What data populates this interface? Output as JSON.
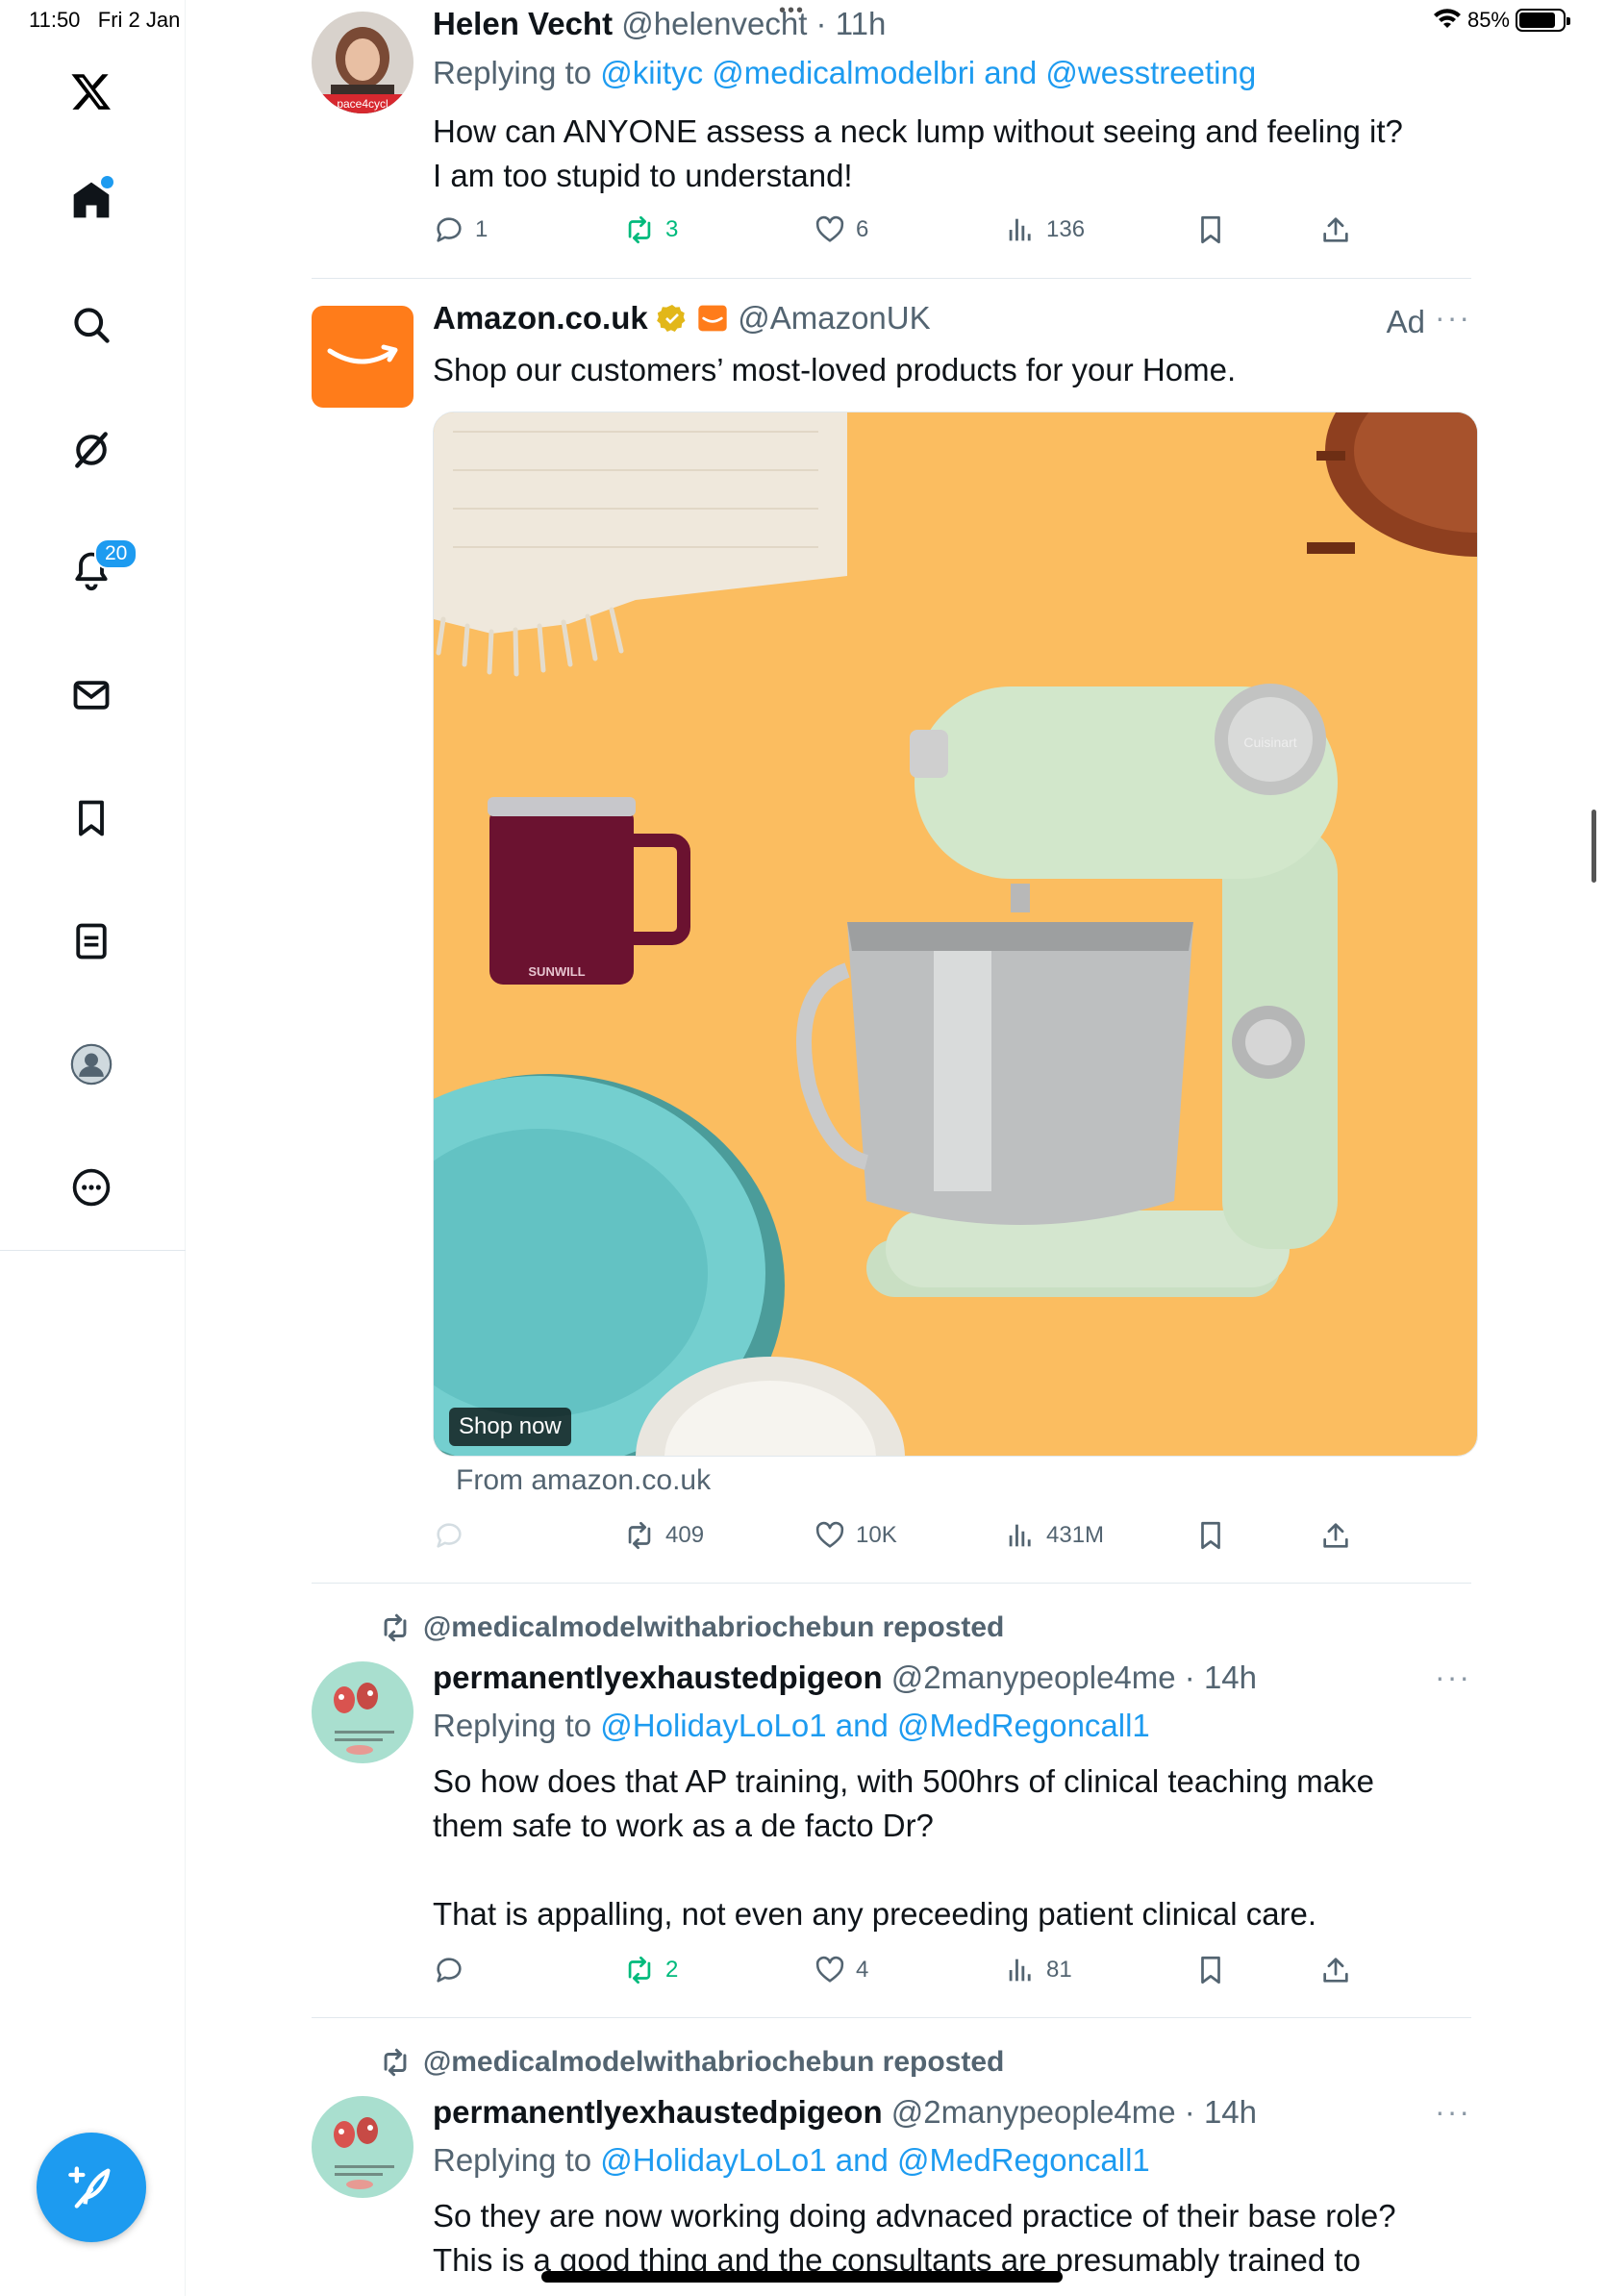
{
  "status_bar": {
    "time": "11:50",
    "date": "Fri 2 Jan",
    "battery": "85%"
  },
  "sidebar": {
    "items": [
      {
        "name": "x-logo-icon"
      },
      {
        "name": "home-icon"
      },
      {
        "name": "search-icon"
      },
      {
        "name": "grok-icon"
      },
      {
        "name": "notifications-icon",
        "badge": "20"
      },
      {
        "name": "messages-icon"
      },
      {
        "name": "bookmarks-icon"
      },
      {
        "name": "lists-icon"
      },
      {
        "name": "profile-icon"
      },
      {
        "name": "more-icon"
      }
    ],
    "compose_icon": "compose-icon"
  },
  "tweets": [
    {
      "name": "Helen Vecht",
      "handle": "@helenvecht",
      "time": "· 11h",
      "replying_prefix": "Replying to ",
      "replying_links": "@kiityc @medicalmodelbri and @wesstreeting",
      "text": "How can ANYONE assess a neck lump without seeing and feeling it?\nI am too stupid to understand!",
      "replies": "1",
      "reposts": "3",
      "likes": "6",
      "views": "136",
      "avatar_label": "pace4cycl"
    },
    {
      "name": "Amazon.co.uk",
      "handle": "@AmazonUK",
      "ad_label": "Ad",
      "text": "Shop our customers’ most-loved products for your Home.",
      "media_cta": "Shop now",
      "mug_brand": "SUNWILL",
      "mixer_brand": "Cuisinart",
      "from": "From amazon.co.uk",
      "reposts": "409",
      "likes": "10K",
      "views": "431M"
    },
    {
      "reposted_by": "@medicalmodelwithabriochebun reposted",
      "name": "permanentlyexhaustedpigeon",
      "handle": "@2manypeople4me",
      "time": "· 14h",
      "replying_prefix": "Replying to ",
      "replying_links": "@HolidayLoLo1 and @MedRegoncall1",
      "text": "So how does that AP training, with 500hrs of clinical teaching make them safe to work as a de facto Dr?\n\nThat is appalling, not even any preceeding patient clinical care.",
      "reposts": "2",
      "likes": "4",
      "views": "81"
    },
    {
      "reposted_by": "@medicalmodelwithabriochebun reposted",
      "name": "permanentlyexhaustedpigeon",
      "handle": "@2manypeople4me",
      "time": "· 14h",
      "replying_prefix": "Replying to ",
      "replying_links": "@HolidayLoLo1 and @MedRegoncall1",
      "text": "So they are now working doing advnaced practice of their base role?\nThis is a good thing and the consultants are presumably trained to"
    }
  ],
  "colors": {
    "accent": "#1d9bf0",
    "repost_active": "#00ba7c",
    "ad_orange": "#ff7c1a",
    "media_bg": "#fbbd60"
  }
}
